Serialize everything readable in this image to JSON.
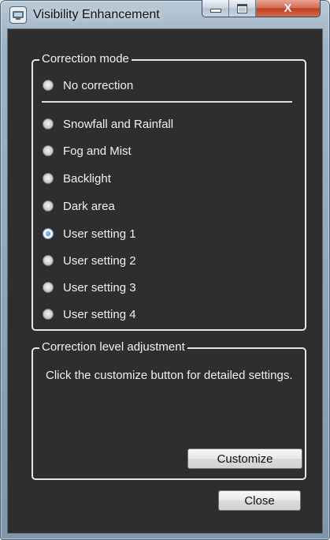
{
  "window": {
    "title": "Visibility Enhancement",
    "close_glyph": "X"
  },
  "correction_mode": {
    "title": "Correction mode",
    "options": [
      {
        "label": "No correction",
        "checked": false
      },
      {
        "label": "Snowfall and Rainfall",
        "checked": false
      },
      {
        "label": "Fog and Mist",
        "checked": false
      },
      {
        "label": "Backlight",
        "checked": false
      },
      {
        "label": "Dark area",
        "checked": false
      },
      {
        "label": "User setting 1",
        "checked": true
      },
      {
        "label": "User setting 2",
        "checked": false
      },
      {
        "label": "User setting 3",
        "checked": false
      },
      {
        "label": "User setting 4",
        "checked": false
      }
    ]
  },
  "level_adjustment": {
    "title": "Correction level adjustment",
    "description": "Click the customize button for detailed settings.",
    "customize_label": "Customize"
  },
  "footer": {
    "close_label": "Close"
  },
  "icons": {
    "app": "camera-monitor-icon",
    "minimize": "minimize-icon",
    "maximize": "maximize-icon",
    "close": "close-icon"
  },
  "colors": {
    "panel_background": "#2e2e2e",
    "text": "#f0f0f0",
    "close_button": "#c0401f",
    "selected_radio": "#1f6fc0"
  }
}
